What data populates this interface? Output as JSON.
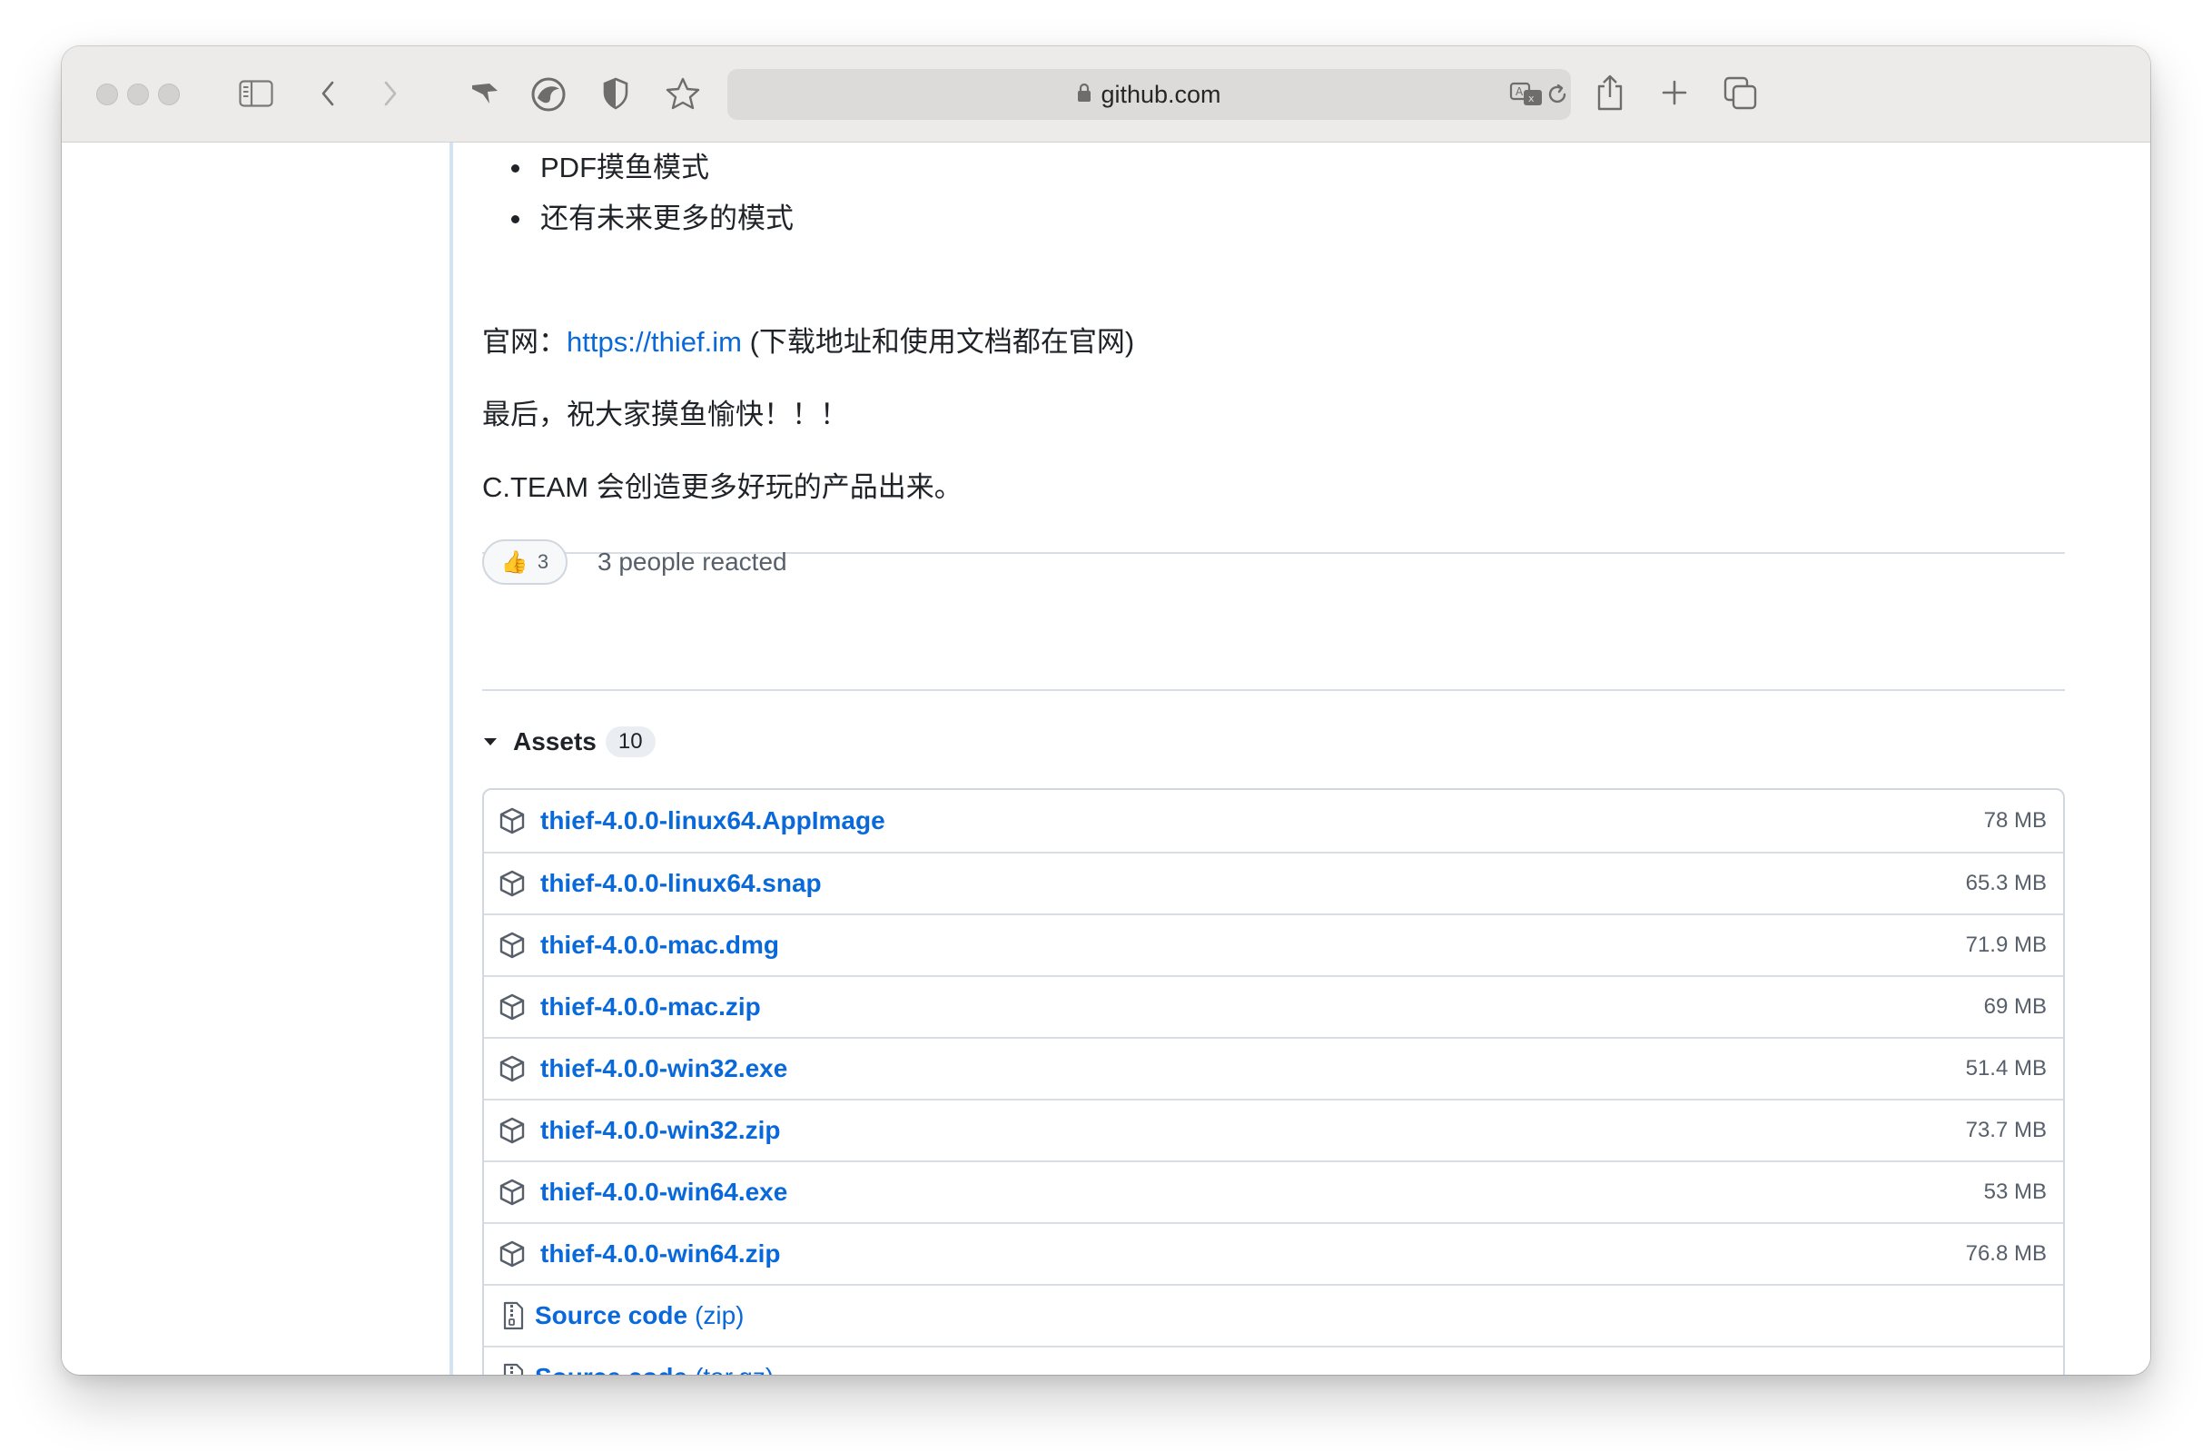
{
  "browser": {
    "address": "github.com"
  },
  "release": {
    "features": [
      "PDF摸鱼模式",
      "还有未来更多的模式"
    ],
    "website_label": "官网：",
    "website_link": "https://thief.im",
    "website_note": " (下载地址和使用文档都在官网)",
    "closing": "最后，祝大家摸鱼愉快！！！",
    "team_note": "C.TEAM 会创造更多好玩的产品出来。"
  },
  "reactions": {
    "emoji": "👍",
    "count": "3",
    "summary": "3 people reacted"
  },
  "assets": {
    "title": "Assets",
    "count": "10",
    "files": [
      {
        "name": "thief-4.0.0-linux64.AppImage",
        "size": "78 MB"
      },
      {
        "name": "thief-4.0.0-linux64.snap",
        "size": "65.3 MB"
      },
      {
        "name": "thief-4.0.0-mac.dmg",
        "size": "71.9 MB"
      },
      {
        "name": "thief-4.0.0-mac.zip",
        "size": "69 MB"
      },
      {
        "name": "thief-4.0.0-win32.exe",
        "size": "51.4 MB"
      },
      {
        "name": "thief-4.0.0-win32.zip",
        "size": "73.7 MB"
      },
      {
        "name": "thief-4.0.0-win64.exe",
        "size": "53 MB"
      },
      {
        "name": "thief-4.0.0-win64.zip",
        "size": "76.8 MB"
      }
    ],
    "source": [
      {
        "name": "Source code",
        "format": "(zip)"
      },
      {
        "name": "Source code",
        "format": "(tar.gz)"
      }
    ]
  },
  "colors": {
    "link": "#0969da",
    "muted": "#57606a",
    "border": "#d0d7de"
  },
  "icons": [
    "sidebar-icon",
    "back-icon",
    "forward-icon",
    "extension-icon",
    "browser-ext-icon",
    "shield-icon",
    "star-icon",
    "lock-icon",
    "translate-icon",
    "reload-icon",
    "share-icon",
    "new-tab-icon",
    "tabs-overview-icon",
    "caret-down-icon",
    "package-icon",
    "file-zip-icon"
  ]
}
